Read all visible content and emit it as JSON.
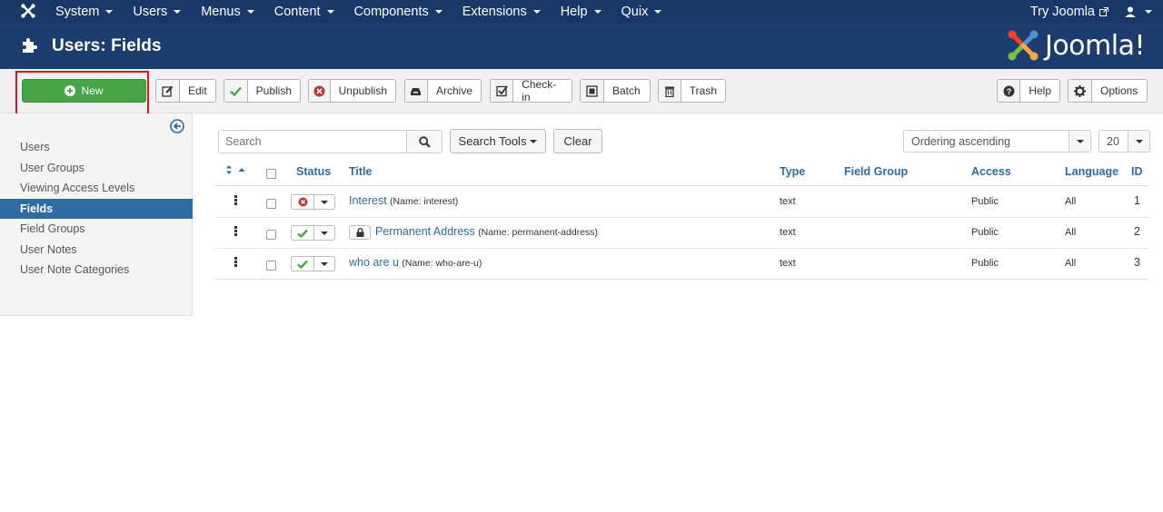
{
  "navbar": {
    "menus": [
      "System",
      "Users",
      "Menus",
      "Content",
      "Components",
      "Extensions",
      "Help",
      "Quix"
    ],
    "try_joomla": "Try Joomla"
  },
  "header": {
    "title": "Users: Fields",
    "logo_text": "Joomla!"
  },
  "toolbar": {
    "new": "New",
    "edit": "Edit",
    "publish": "Publish",
    "unpublish": "Unpublish",
    "archive": "Archive",
    "checkin": "Check-in",
    "batch": "Batch",
    "trash": "Trash",
    "help": "Help",
    "options": "Options"
  },
  "sidebar": {
    "items": [
      {
        "label": "Users"
      },
      {
        "label": "User Groups"
      },
      {
        "label": "Viewing Access Levels"
      },
      {
        "label": "Fields"
      },
      {
        "label": "Field Groups"
      },
      {
        "label": "User Notes"
      },
      {
        "label": "User Note Categories"
      }
    ],
    "active_index": 3
  },
  "filters": {
    "search_placeholder": "Search",
    "search_tools": "Search Tools",
    "clear": "Clear",
    "ordering": "Ordering ascending",
    "limit": "20"
  },
  "table": {
    "headers": {
      "status": "Status",
      "title": "Title",
      "type": "Type",
      "field_group": "Field Group",
      "access": "Access",
      "language": "Language",
      "id": "ID"
    },
    "rows": [
      {
        "title": "Interest",
        "name": "(Name: interest)",
        "type": "text",
        "access": "Public",
        "language": "All",
        "id": "1",
        "status": "unpublished",
        "locked": false
      },
      {
        "title": "Permanent Address",
        "name": "(Name: permanent-address)",
        "type": "text",
        "access": "Public",
        "language": "All",
        "id": "2",
        "status": "published",
        "locked": true
      },
      {
        "title": "who are u",
        "name": "(Name: who-are-u)",
        "type": "text",
        "access": "Public",
        "language": "All",
        "id": "3",
        "status": "published",
        "locked": false
      }
    ]
  },
  "colors": {
    "navbar": "#1a3867",
    "header": "#1c3d6d",
    "new_button": "#46a546",
    "active_sidebar": "#2d6ca2",
    "link": "#2d6ca2",
    "highlight": "#e0161c",
    "published": "#46a546",
    "unpublished": "#bd362f"
  },
  "icons": {
    "nav_logo": "joomla-icon",
    "header": "puzzle-icon",
    "new": "plus-circle-icon",
    "edit": "edit-icon",
    "publish": "check-icon",
    "unpublish": "times-circle-icon",
    "archive": "archive-icon",
    "checkin": "checkbox-icon",
    "batch": "square-icon",
    "trash": "trash-icon",
    "help": "question-circle-icon",
    "options": "gear-icon",
    "collapse": "circle-arrow-left-icon",
    "search": "search-icon",
    "lock": "lock-icon"
  }
}
